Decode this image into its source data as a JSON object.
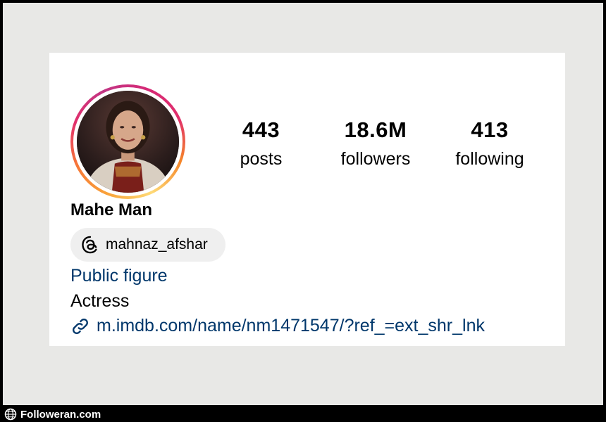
{
  "profile": {
    "display_name": "Mahe Man",
    "threads_handle": "mahnaz_afshar",
    "category": "Public figure",
    "bio": "Actress",
    "link": "m.imdb.com/name/nm1471547/?ref_=ext_shr_lnk"
  },
  "stats": {
    "posts": {
      "value": "443",
      "label": "posts"
    },
    "followers": {
      "value": "18.6M",
      "label": "followers"
    },
    "following": {
      "value": "413",
      "label": "following"
    }
  },
  "icons": {
    "threads": "threads-icon",
    "link": "link-icon",
    "globe": "globe-icon"
  },
  "colors": {
    "link_blue": "#00376b",
    "chip_bg": "#efefef",
    "page_bg": "#e8e8e6"
  },
  "watermark": {
    "text": "Followeran.com"
  }
}
